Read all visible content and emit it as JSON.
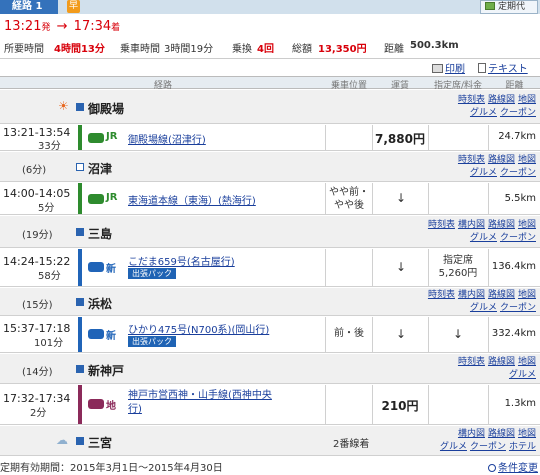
{
  "header": {
    "route_label": "経路 1",
    "badge": "早",
    "teiki_label": "定期代"
  },
  "times": {
    "dep": "13:21",
    "dep_suffix": "発",
    "arrow": "→",
    "arr": "17:34",
    "arr_suffix": "着"
  },
  "summary": {
    "total_label": "所要時間",
    "total_value": "4時間13分",
    "ride_label": "乗車時間",
    "ride_value": "3時間19分",
    "transfer_label": "乗換",
    "transfer_value": "4回",
    "fare_label": "総額",
    "fare_value": "13,350円",
    "dist_label": "距離",
    "dist_value": "500.3km"
  },
  "actions": {
    "print": "印刷",
    "text": "テキスト"
  },
  "table_header": {
    "route": "経路",
    "position": "乗車位置",
    "fare": "運賃",
    "seat": "指定席/料金",
    "distance": "距離"
  },
  "stations": [
    {
      "name": "御殿場",
      "wait": "",
      "links": [
        "時刻表",
        "路線図",
        "地図",
        "グルメ",
        "クーポン"
      ],
      "position": ""
    },
    {
      "name": "沼津",
      "wait": "(6分)",
      "links": [
        "時刻表",
        "路線図",
        "地図",
        "グルメ",
        "クーポン"
      ],
      "position": ""
    },
    {
      "name": "三島",
      "wait": "(19分)",
      "links": [
        "時刻表",
        "構内図",
        "路線図",
        "地図",
        "グルメ",
        "クーポン"
      ],
      "position": ""
    },
    {
      "name": "浜松",
      "wait": "(15分)",
      "links": [
        "時刻表",
        "構内図",
        "路線図",
        "地図",
        "グルメ",
        "クーポン"
      ],
      "position": ""
    },
    {
      "name": "新神戸",
      "wait": "(14分)",
      "links": [
        "時刻表",
        "路線図",
        "地図",
        "グルメ"
      ],
      "position": ""
    },
    {
      "name": "三宮",
      "wait": "",
      "links": [
        "構内図",
        "路線図",
        "地図",
        "グルメ",
        "クーポン",
        "ホテル"
      ],
      "position": "2番線着"
    }
  ],
  "segments": [
    {
      "time": "13:21-13:54",
      "duration": "33分",
      "company": "JR",
      "line": "御殿場線(沼津行)",
      "position": "",
      "fare": "7,880円",
      "seat_fare": "",
      "pack": "",
      "distance": "24.7km"
    },
    {
      "time": "14:00-14:05",
      "duration": "5分",
      "company": "JR",
      "line": "東海道本線（東海）(熱海行)",
      "position": "やや前・やや後",
      "fare": "↓",
      "seat_fare": "",
      "pack": "",
      "distance": "5.5km"
    },
    {
      "time": "14:24-15:22",
      "duration": "58分",
      "company": "新",
      "line": "こだま659号(名古屋行)",
      "position": "",
      "fare": "↓",
      "seat_fare": "指定席 5,260円",
      "pack": "出張パック",
      "distance": "136.4km"
    },
    {
      "time": "15:37-17:18",
      "duration": "101分",
      "company": "新",
      "line": "ひかり475号(N700系)(岡山行)",
      "position": "前・後",
      "fare": "↓",
      "seat_fare": "↓",
      "pack": "出張パック",
      "distance": "332.4km"
    },
    {
      "time": "17:32-17:34",
      "duration": "2分",
      "company": "地",
      "line": "神戸市営西神・山手線(西神中央行)",
      "position": "",
      "fare": "210円",
      "seat_fare": "",
      "pack": "",
      "distance": "1.3km"
    }
  ],
  "footer": {
    "validity": "定期有効期間：2015年3月1日〜2015年4月30日",
    "conditions": "条件変更"
  },
  "colors": {
    "accent": "#d8000a",
    "tab": "#3472bb",
    "link": "#1a3f9c",
    "jr_green": "#2e8b2e",
    "shinkansen_blue": "#2064b8",
    "subway_purple": "#8b2a5a"
  }
}
